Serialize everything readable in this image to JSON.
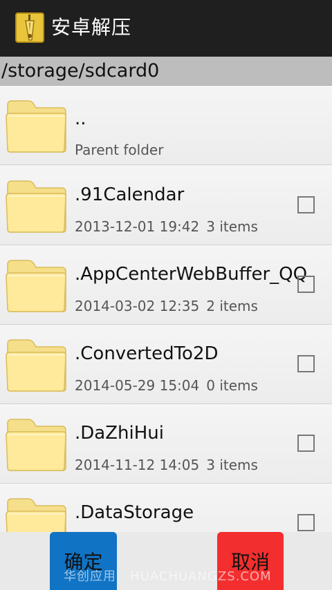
{
  "app": {
    "title": "安卓解压",
    "icon": "zip-archive-icon"
  },
  "path": "/storage/sdcard0",
  "items": [
    {
      "name": "..",
      "date": "",
      "count": "",
      "subtitle": "Parent folder",
      "checkbox": false
    },
    {
      "name": ".91Calendar",
      "date": "2013-12-01 19:42",
      "count": "3 items",
      "subtitle": "",
      "checkbox": true
    },
    {
      "name": ".AppCenterWebBuffer_QQ",
      "date": "2014-03-02 12:35",
      "count": "2 items",
      "subtitle": "",
      "checkbox": true
    },
    {
      "name": ".ConvertedTo2D",
      "date": "2014-05-29 15:04",
      "count": "0 items",
      "subtitle": "",
      "checkbox": true
    },
    {
      "name": ".DaZhiHui",
      "date": "2014-11-12 14:05",
      "count": "3 items",
      "subtitle": "",
      "checkbox": true
    },
    {
      "name": ".DataStorage",
      "date": "",
      "count": "",
      "subtitle": "",
      "checkbox": true
    }
  ],
  "buttons": {
    "confirm": "确定",
    "cancel": "取消"
  },
  "watermark": "华创应用 · HUACHUANGZS.COM",
  "colors": {
    "confirm": "#1173c3",
    "cancel": "#f32e2e",
    "action_bar": "#1f1f1f"
  }
}
